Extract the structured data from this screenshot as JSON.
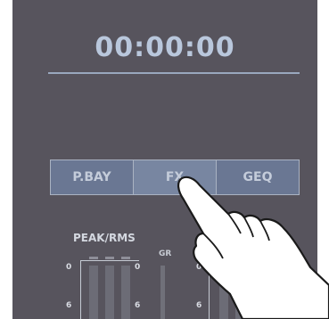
{
  "display": {
    "time": "00:00:00"
  },
  "tabs": [
    {
      "label": "P.BAY",
      "selected": false
    },
    {
      "label": "FX",
      "selected": true
    },
    {
      "label": "GEQ",
      "selected": false
    }
  ],
  "meter": {
    "title": "PEAK/RMS",
    "gr_label": "GR",
    "scale_labels": [
      "0",
      "6"
    ]
  },
  "colors": {
    "screen_bg": "#57545d",
    "time_text": "#b9c7dc",
    "tab_bg": "#6a7793",
    "tab_text": "#c4ccda"
  },
  "icons": {
    "touch_hand": "pointing-hand-icon"
  }
}
